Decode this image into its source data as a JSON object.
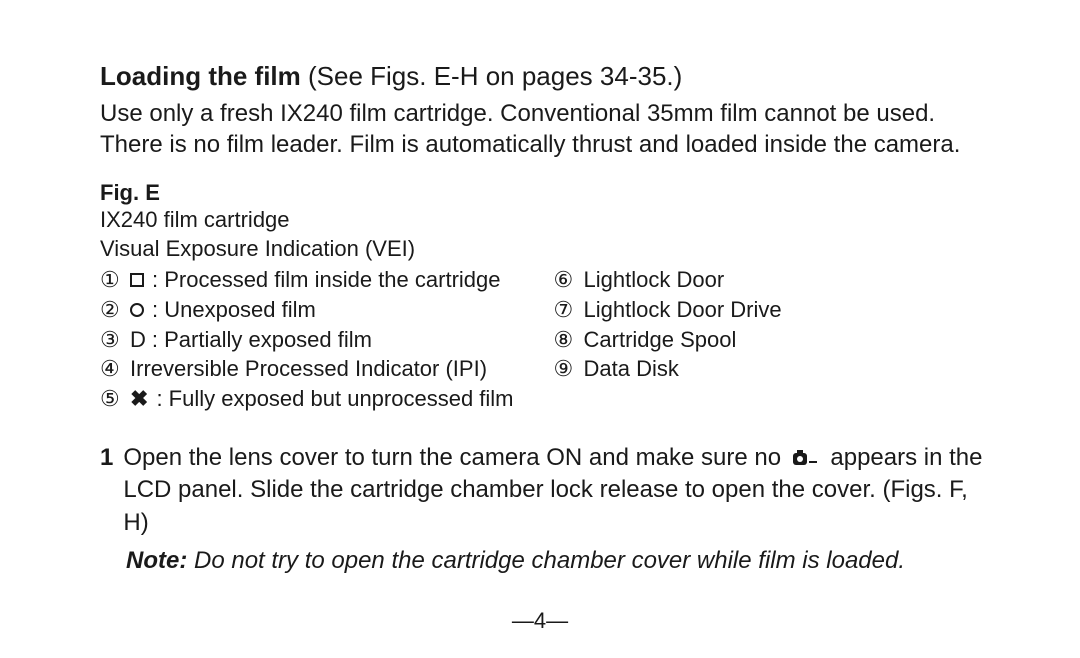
{
  "title": {
    "bold": "Loading the film",
    "rest": " (See Figs. E-H on pages 34-35.)"
  },
  "intro": "Use only a fresh IX240 film cartridge. Conventional 35mm film cannot be used. There is no film leader. Film is automatically thrust and loaded inside the camera.",
  "figE": {
    "label": "Fig. E",
    "line1": "IX240 film cartridge",
    "line2": "Visual Exposure Indication (VEI)",
    "left": [
      {
        "num": "①",
        "symbol": "square",
        "text": ": Processed film inside the cartridge"
      },
      {
        "num": "②",
        "symbol": "circle",
        "text": ": Unexposed film"
      },
      {
        "num": "③",
        "symbol": "D",
        "text": " : Partially exposed film"
      },
      {
        "num": "④",
        "symbol": "",
        "text": "Irreversible Processed Indicator (IPI)"
      },
      {
        "num": "⑤",
        "symbol": "x",
        "text": ": Fully exposed but unprocessed film"
      }
    ],
    "right": [
      {
        "num": "⑥",
        "text": "Lightlock Door"
      },
      {
        "num": "⑦",
        "text": "Lightlock Door Drive"
      },
      {
        "num": "⑧",
        "text": "Cartridge Spool"
      },
      {
        "num": "⑨",
        "text": "Data Disk"
      }
    ]
  },
  "step1": {
    "num": "1",
    "before": "Open the lens cover to turn the camera ON and make sure no ",
    "after": " appears in the LCD panel. Slide the cartridge chamber lock release to open the cover. (Figs. F, H)"
  },
  "note": {
    "label": "Note:",
    "body": " Do not try to open the cartridge chamber cover while film is loaded."
  },
  "pagenum": "—4—"
}
